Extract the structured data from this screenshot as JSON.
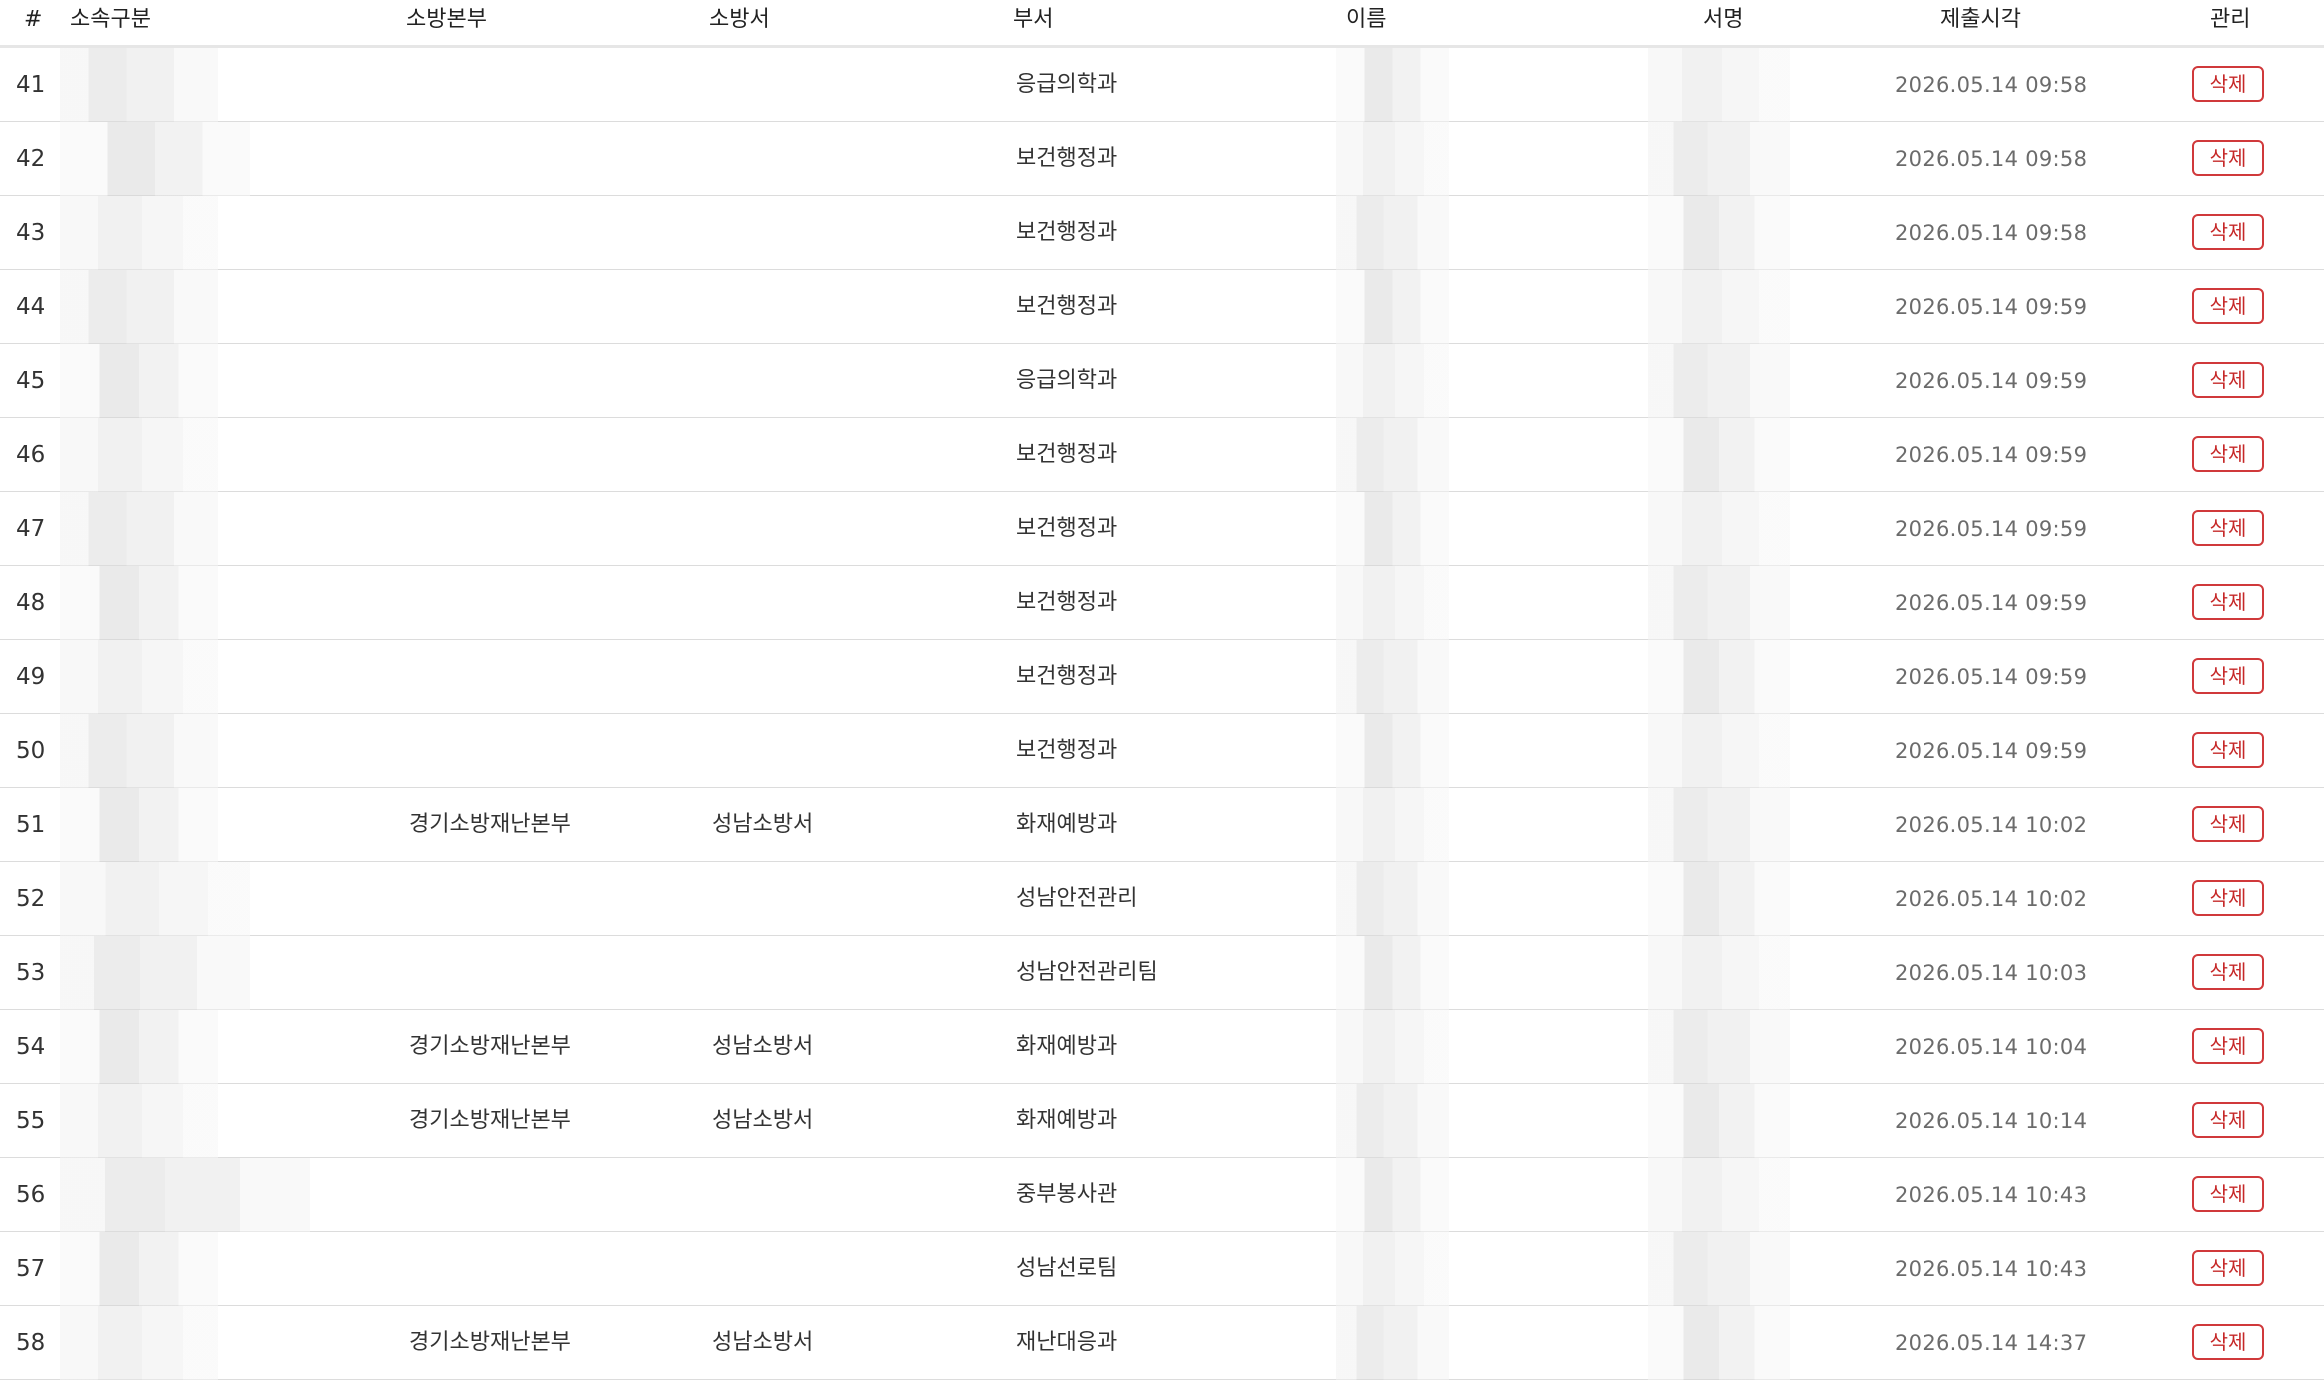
{
  "columns": {
    "num": "#",
    "affiliation": "소속구분",
    "hq": "소방본부",
    "station": "소방서",
    "dept": "부서",
    "name": "이름",
    "signature": "서명",
    "submitted": "제출시각",
    "manage": "관리"
  },
  "delete_label": "삭제",
  "rows": [
    {
      "num": "41",
      "hq": "",
      "station": "",
      "dept": "응급의학과",
      "time": "2026.05.14 09:58"
    },
    {
      "num": "42",
      "hq": "",
      "station": "",
      "dept": "보건행정과",
      "time": "2026.05.14 09:58"
    },
    {
      "num": "43",
      "hq": "",
      "station": "",
      "dept": "보건행정과",
      "time": "2026.05.14 09:58"
    },
    {
      "num": "44",
      "hq": "",
      "station": "",
      "dept": "보건행정과",
      "time": "2026.05.14 09:59"
    },
    {
      "num": "45",
      "hq": "",
      "station": "",
      "dept": "응급의학과",
      "time": "2026.05.14 09:59"
    },
    {
      "num": "46",
      "hq": "",
      "station": "",
      "dept": "보건행정과",
      "time": "2026.05.14 09:59"
    },
    {
      "num": "47",
      "hq": "",
      "station": "",
      "dept": "보건행정과",
      "time": "2026.05.14 09:59"
    },
    {
      "num": "48",
      "hq": "",
      "station": "",
      "dept": "보건행정과",
      "time": "2026.05.14 09:59"
    },
    {
      "num": "49",
      "hq": "",
      "station": "",
      "dept": "보건행정과",
      "time": "2026.05.14 09:59"
    },
    {
      "num": "50",
      "hq": "",
      "station": "",
      "dept": "보건행정과",
      "time": "2026.05.14 09:59"
    },
    {
      "num": "51",
      "hq": "경기소방재난본부",
      "station": "성남소방서",
      "dept": "화재예방과",
      "time": "2026.05.14 10:02"
    },
    {
      "num": "52",
      "hq": "",
      "station": "",
      "dept": "성남안전관리",
      "time": "2026.05.14 10:02"
    },
    {
      "num": "53",
      "hq": "",
      "station": "",
      "dept": "성남안전관리팀",
      "time": "2026.05.14 10:03"
    },
    {
      "num": "54",
      "hq": "경기소방재난본부",
      "station": "성남소방서",
      "dept": "화재예방과",
      "time": "2026.05.14 10:04"
    },
    {
      "num": "55",
      "hq": "경기소방재난본부",
      "station": "성남소방서",
      "dept": "화재예방과",
      "time": "2026.05.14 10:14"
    },
    {
      "num": "56",
      "hq": "",
      "station": "",
      "dept": "중부봉사관",
      "time": "2026.05.14 10:43"
    },
    {
      "num": "57",
      "hq": "",
      "station": "",
      "dept": "성남선로팀",
      "time": "2026.05.14 10:43"
    },
    {
      "num": "58",
      "hq": "경기소방재난본부",
      "station": "성남소방서",
      "dept": "재난대응과",
      "time": "2026.05.14 14:37"
    }
  ]
}
